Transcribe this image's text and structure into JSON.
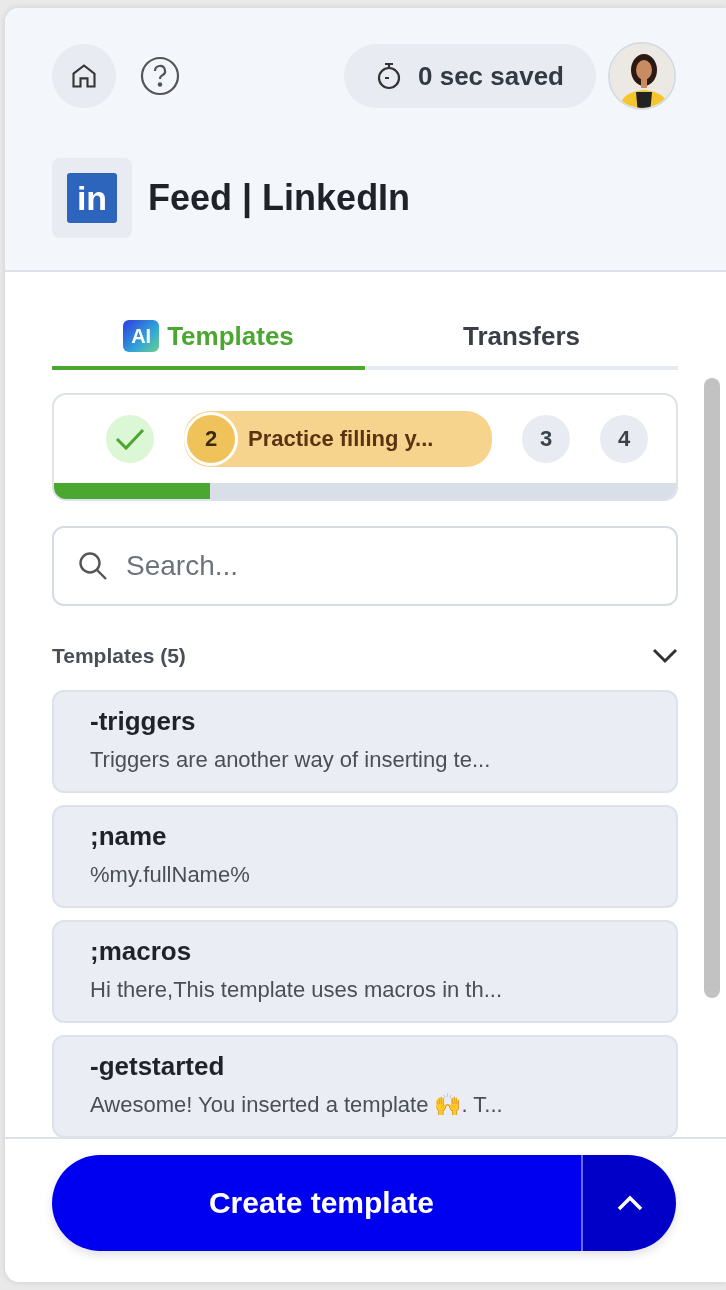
{
  "header": {
    "saved": "0 sec saved",
    "page_title": "Feed | LinkedIn",
    "site_icon": "in"
  },
  "tabs": [
    {
      "label": "Templates",
      "badge": "AI",
      "selected": true
    },
    {
      "label": "Transfers",
      "selected": false
    }
  ],
  "onboarding": {
    "steps": [
      {
        "kind": "done"
      },
      {
        "kind": "current",
        "number": "2",
        "label": "Practice filling y..."
      },
      {
        "kind": "pending",
        "number": "3"
      },
      {
        "kind": "pending",
        "number": "4"
      }
    ],
    "level": 0.25
  },
  "search": {
    "placeholder": "Search..."
  },
  "templates": {
    "title": "Templates (5)",
    "expanded": true,
    "items": [
      {
        "shortcut": "-triggers",
        "preview": "Triggers are another way of inserting te..."
      },
      {
        "shortcut": ";name",
        "preview": "%my.fullName%"
      },
      {
        "shortcut": ";macros",
        "preview": "Hi there,This template uses macros in th..."
      },
      {
        "shortcut": "-getstarted",
        "preview": "Awesome! You inserted a template 🙌. T..."
      }
    ]
  },
  "footer": {
    "button": "Create template"
  }
}
